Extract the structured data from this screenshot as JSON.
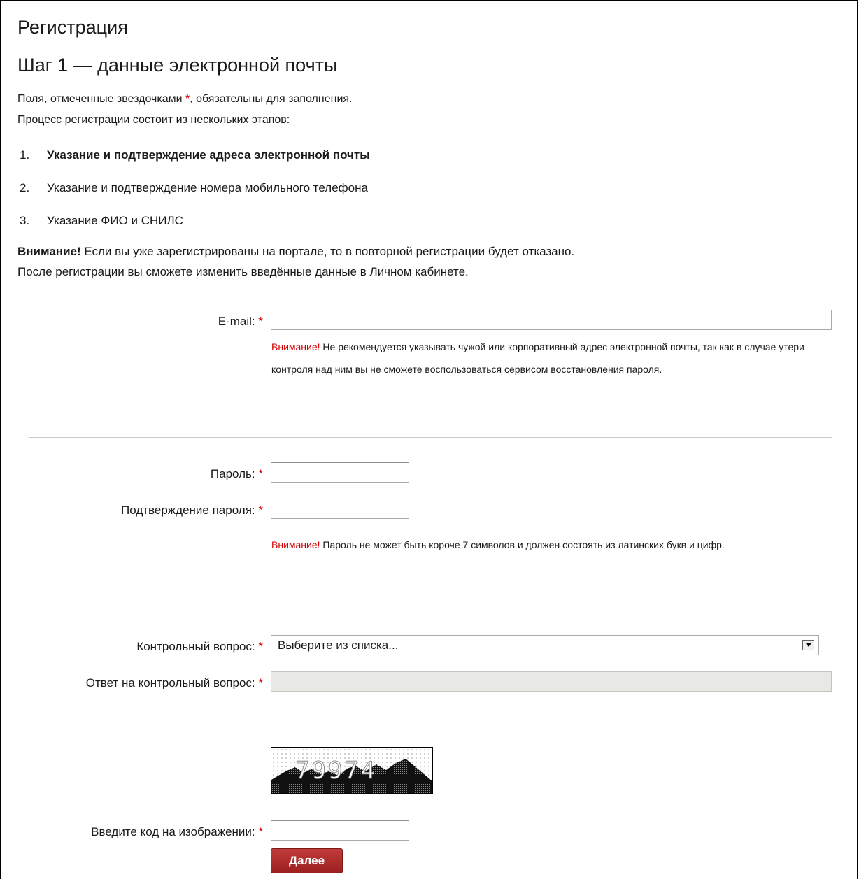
{
  "page": {
    "title": "Регистрация",
    "step_title": "Шаг 1 — данные электронной почты"
  },
  "intro": {
    "required_text_before": "Поля, отмеченные звездочками ",
    "required_star": "*",
    "required_text_after": ", обязательны для заполнения.",
    "process_text": "Процесс регистрации состоит из нескольких этапов:"
  },
  "steps": [
    {
      "num": "1.",
      "label": "Указание и подтверждение адреса электронной почты",
      "active": true
    },
    {
      "num": "2.",
      "label": "Указание и подтверждение номера мобильного телефона",
      "active": false
    },
    {
      "num": "3.",
      "label": "Указание ФИО и СНИЛС",
      "active": false
    }
  ],
  "warning": {
    "bold": "Внимание!",
    "text": " Если вы уже зарегистрированы на портале, то в повторной регистрации будет отказано.",
    "line2": "После регистрации вы сможете изменить введённые данные в Личном кабинете."
  },
  "form": {
    "email": {
      "label": "E-mail:",
      "value": "",
      "note_warn": "Внимание!",
      "note_text": " Не рекомендуется указывать чужой или корпоративный адрес электронной почты, так как в случае утери контроля над ним вы не сможете воспользоваться сервисом восстановления пароля."
    },
    "password": {
      "label": "Пароль:",
      "value": ""
    },
    "password_confirm": {
      "label": "Подтверждение пароля:",
      "value": "",
      "note_warn": "Внимание!",
      "note_text": " Пароль не может быть короче 7 символов и должен состоять из латинских букв и цифр."
    },
    "security_question": {
      "label": "Контрольный вопрос:",
      "selected": "Выберите из списка..."
    },
    "security_answer": {
      "label": "Ответ на контрольный вопрос:",
      "value": ""
    },
    "captcha": {
      "code": "79974",
      "label": "Введите код на изображении:",
      "value": ""
    },
    "required_mark": "*",
    "submit_label": "Далее"
  },
  "colors": {
    "required": "#d40000",
    "button": "#a92727",
    "divider": "#c8c8c8"
  }
}
